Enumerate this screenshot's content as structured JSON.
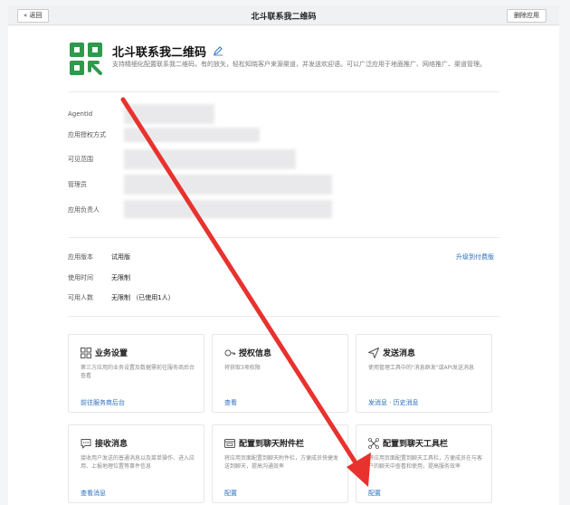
{
  "topbar": {
    "back_label": "« 返回",
    "title": "北斗联系我二维码",
    "delete_label": "删除应用"
  },
  "app": {
    "name": "北斗联系我二维码",
    "description": "支持精细化配置联系我二维码，有的放矢，轻松知晓客户来源渠道，并发送欢迎语。可以广泛应用于地面推广、网络推广、渠道管理。"
  },
  "info": {
    "labels": [
      "AgentId",
      "应用授权方式",
      "可见范围",
      "管理员",
      "应用负责人"
    ]
  },
  "version": {
    "rows": [
      {
        "label": "应用版本",
        "value": "试用版"
      },
      {
        "label": "使用时间",
        "value": "无限制"
      },
      {
        "label": "可用人数",
        "value": "无限制 （已使用1人）"
      }
    ],
    "upgrade_label": "升级到付费版"
  },
  "tiles": [
    {
      "icon": "grid-icon",
      "title": "业务设置",
      "desc": "第三方应用的业务设置及数据需前往服务商后台查看",
      "link": "前往服务商后台"
    },
    {
      "icon": "key-icon",
      "title": "授权信息",
      "desc": "将获取3项权限",
      "link": "查看"
    },
    {
      "icon": "send-icon",
      "title": "发送消息",
      "desc": "使用管理工具中的\"消息群发\"或API发送消息",
      "link": "发消息 · 历史消息"
    },
    {
      "icon": "chat-icon",
      "title": "接收消息",
      "desc": "接收用户发送的普通消息以及菜单操作、进入应用、上报地理位置等事件信息",
      "link": "查看消息"
    },
    {
      "icon": "attachment-icon",
      "title": "配置到聊天附件栏",
      "desc": "将应用页面配置到聊天附件栏，方便成员快捷发送到聊天，提高沟通效率",
      "link": "配置"
    },
    {
      "icon": "toolbar-icon",
      "title": "配置到聊天工具栏",
      "desc": "将应用页面配置到聊天工具栏，方便成员在与客户的聊天中查看和使用，提高服务效率",
      "link": "配置"
    }
  ],
  "colors": {
    "brand_green": "#2e9a4c",
    "link_blue": "#2a6fbf",
    "annotation_red": "#e8322e"
  }
}
